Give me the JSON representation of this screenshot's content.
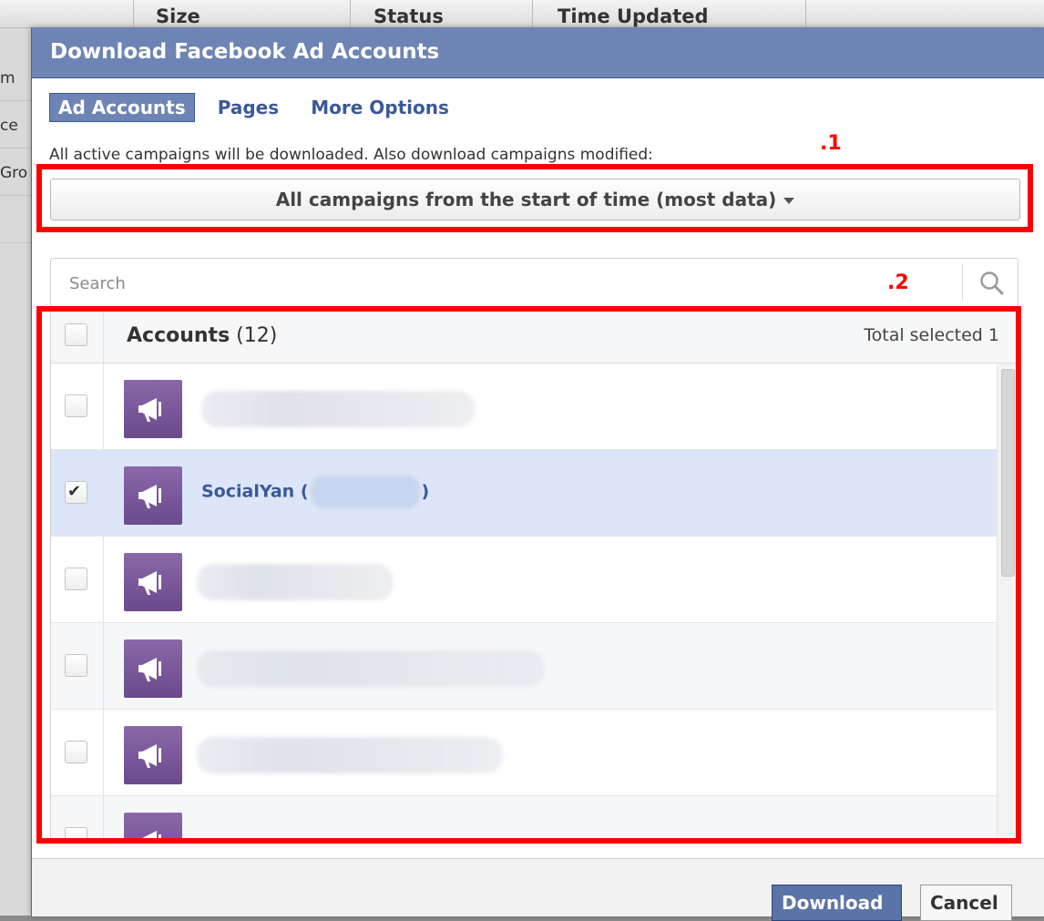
{
  "background_table": {
    "columns": [
      "Size",
      "Status",
      "Time Updated"
    ],
    "row_fragments": [
      "m",
      "ce",
      "Gro"
    ]
  },
  "dialog": {
    "title": "Download Facebook Ad Accounts",
    "tabs": [
      {
        "label": "Ad Accounts",
        "active": true
      },
      {
        "label": "Pages",
        "active": false
      },
      {
        "label": "More Options",
        "active": false
      }
    ],
    "description": "All active campaigns will be downloaded. Also download campaigns modified:",
    "timeframe_dropdown": {
      "selected": "All campaigns from the start of time (most data)",
      "icon": "caret-down-icon"
    },
    "search": {
      "placeholder": "Search",
      "value": "",
      "icon": "search-icon"
    },
    "accounts_list": {
      "title": "Accounts",
      "count": "(12)",
      "total_selected": "Total selected 1",
      "rows": [
        {
          "name": "",
          "checked": false,
          "redacted": true
        },
        {
          "name_prefix": "SocialYan (",
          "name_suffix": ")",
          "checked": true,
          "redacted_middle": true
        },
        {
          "name": "",
          "checked": false,
          "redacted": true
        },
        {
          "name": "",
          "checked": false,
          "redacted": true
        },
        {
          "name": "",
          "checked": false,
          "redacted": true
        }
      ],
      "row_icon": "megaphone-icon"
    },
    "buttons": {
      "download": "Download",
      "cancel": "Cancel"
    }
  },
  "annotations": {
    "label_1": ".1",
    "label_2": ".2",
    "color": "#ff0000"
  },
  "colors": {
    "header_blue": "#6d84b4",
    "link_blue": "#3b5998",
    "selected_row": "#dde6f8",
    "account_icon_purple": "#7a58a0"
  }
}
